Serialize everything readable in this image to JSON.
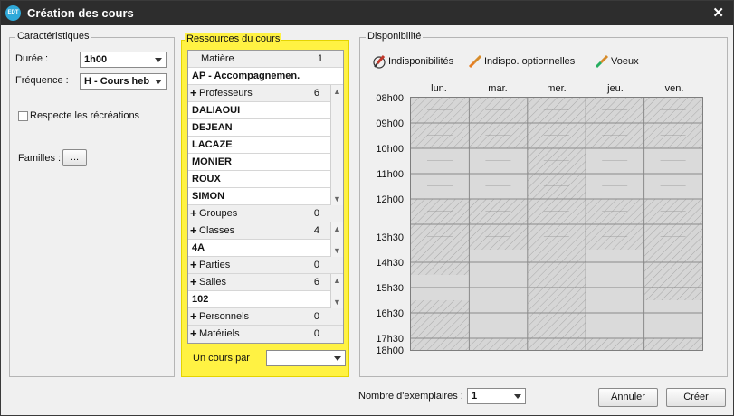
{
  "window": {
    "title": "Création des cours",
    "app_icon": "EDT"
  },
  "caracteristiques": {
    "legend": "Caractéristiques",
    "duree_label": "Durée :",
    "duree_value": "1h00",
    "frequence_label": "Fréquence :",
    "frequence_value": "H - Cours heb",
    "recreations_label": "Respecte les récréations",
    "familles_label": "Familles :",
    "familles_button": "..."
  },
  "ressources": {
    "legend": "Ressources du cours",
    "matiere_label": "Matière",
    "matiere_count": "1",
    "matiere_value": "AP - Accompagnemen.",
    "professeurs_label": "Professeurs",
    "professeurs_count": "6",
    "professeurs": [
      "DALIAOUI",
      "DEJEAN",
      "LACAZE",
      "MONIER",
      "ROUX",
      "SIMON"
    ],
    "groupes_label": "Groupes",
    "groupes_count": "0",
    "classes_label": "Classes",
    "classes_count": "4",
    "classes_value": "4A",
    "parties_label": "Parties",
    "parties_count": "0",
    "salles_label": "Salles",
    "salles_count": "6",
    "salles_value": "102",
    "personnels_label": "Personnels",
    "personnels_count": "0",
    "materiels_label": "Matériels",
    "materiels_count": "0",
    "un_cours_par_label": "Un cours par",
    "un_cours_par_value": ""
  },
  "disponibilite": {
    "legend": "Disponibilité",
    "tools": [
      "Indisponibilités",
      "Indispo. optionnelles",
      "Voeux"
    ],
    "days": [
      "lun.",
      "mar.",
      "mer.",
      "jeu.",
      "ven."
    ],
    "hours": [
      "08h00",
      "09h00",
      "10h00",
      "11h00",
      "12h00",
      "13h30",
      "14h30",
      "15h30",
      "16h30",
      "17h30",
      "18h00"
    ],
    "colors": {
      "hatched": "#cfcfcf",
      "free": "#dadada",
      "highlight": "#fff243"
    }
  },
  "footer": {
    "exemplaires_label": "Nombre d'exemplaires :",
    "exemplaires_value": "1",
    "annuler": "Annuler",
    "creer": "Créer"
  }
}
